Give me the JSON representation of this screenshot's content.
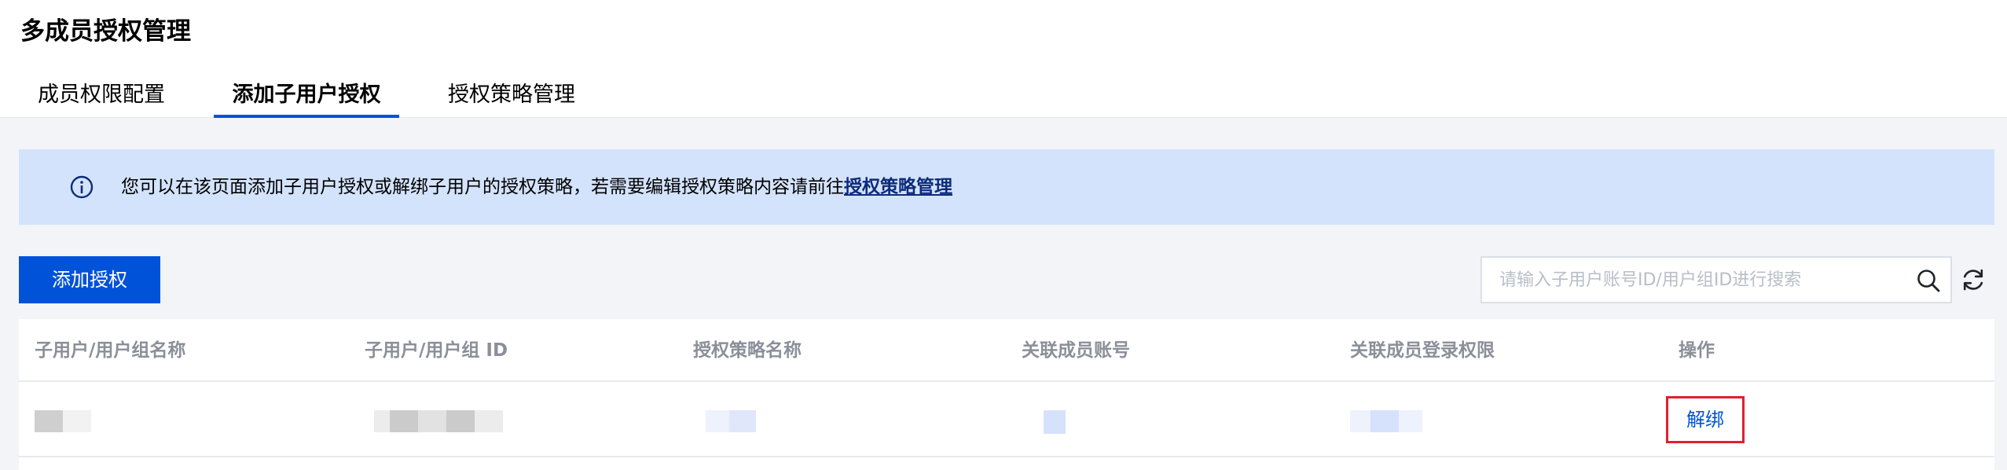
{
  "page": {
    "title": "多成员授权管理"
  },
  "tabs": [
    {
      "label": "成员权限配置",
      "active": false
    },
    {
      "label": "添加子用户授权",
      "active": true
    },
    {
      "label": "授权策略管理",
      "active": false
    }
  ],
  "notice": {
    "icon": "info-circle-icon",
    "text": "您可以在该页面添加子用户授权或解绑子用户的授权策略，若需要编辑授权策略内容请前往",
    "link_label": "授权策略管理"
  },
  "toolbar": {
    "add_label": "添加授权",
    "search_placeholder": "请输入子用户账号ID/用户组ID进行搜索",
    "search_value": ""
  },
  "table": {
    "headers": [
      "子用户/用户组名称",
      "子用户/用户组 ID",
      "授权策略名称",
      "关联成员账号",
      "关联成员登录权限",
      "操作"
    ],
    "rows": [
      {
        "action_label": "解绑"
      }
    ]
  },
  "colors": {
    "primary": "#0052d9",
    "notice_bg": "#d4e3fc",
    "highlight_border": "#e0202f"
  }
}
